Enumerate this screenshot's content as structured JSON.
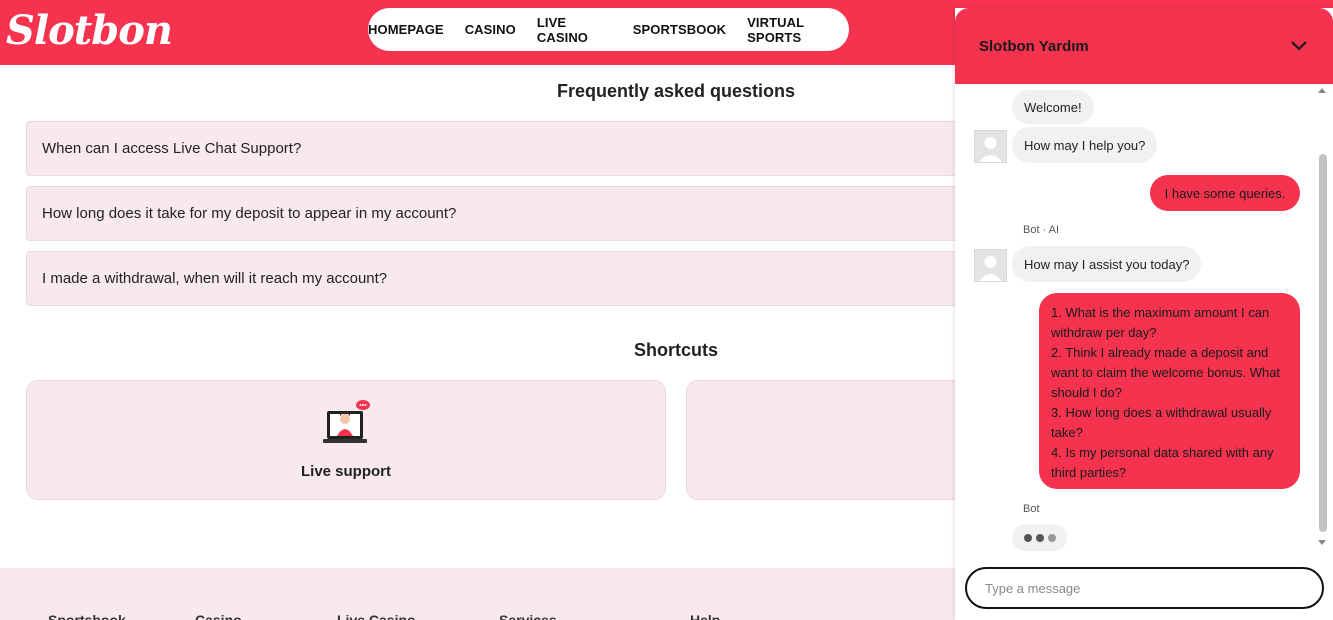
{
  "brand": {
    "logo": "Slotbon",
    "accent": "#f5334f",
    "soft_bg": "#f8e9ef"
  },
  "nav": [
    "HOMEPAGE",
    "CASINO",
    "LIVE CASINO",
    "SPORTSBOOK",
    "VIRTUAL SPORTS"
  ],
  "faq": {
    "title": "Frequently asked questions",
    "items": [
      "When can I access Live Chat Support?",
      "How long does it take for my deposit to appear in my account?",
      "I made a withdrawal, when will it reach my account?"
    ]
  },
  "shortcuts": {
    "title": "Shortcuts",
    "items": [
      {
        "label": "Live support",
        "icon": "live-support-icon"
      },
      {
        "label": "",
        "icon": ""
      }
    ]
  },
  "footer": [
    "Sportsbook",
    "Casino",
    "Live Casino",
    "Services",
    "Help"
  ],
  "chat": {
    "title": "Slotbon Yardım",
    "messages": [
      {
        "from": "bot",
        "text": "Welcome!"
      },
      {
        "from": "bot",
        "text": "How may I help you?"
      },
      {
        "from": "user",
        "text": "I have some queries."
      },
      {
        "from": "bot",
        "sender": "Bot · AI",
        "text": "How may I assist you today?"
      },
      {
        "from": "user",
        "text": "1. What is the maximum amount I can withdraw per day?\n2. Think I already made a deposit and want to claim the welcome bonus. What should I do?\n3. How long does a withdrawal usually take?\n4. Is my personal data shared with any third parties?"
      },
      {
        "from": "bot",
        "sender": "Bot",
        "typing": true
      }
    ],
    "input_placeholder": "Type a message"
  }
}
